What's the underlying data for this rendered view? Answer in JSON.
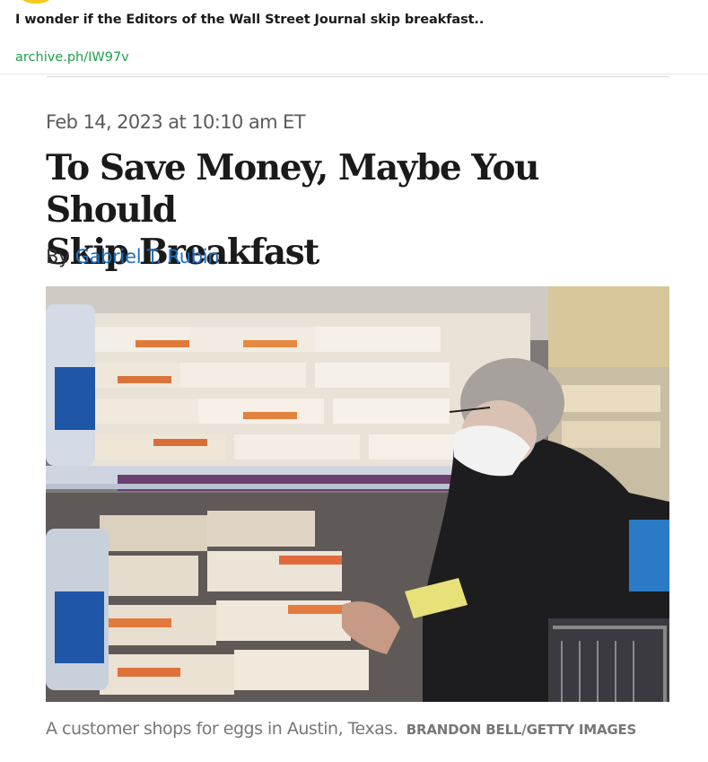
{
  "post": {
    "text": "I wonder if the Editors of the Wall Street Journal skip breakfast..",
    "link": "archive.ph/IW97v"
  },
  "article": {
    "timestamp": "Feb 14, 2023 at 10:10 am ET",
    "headline_line1": "To Save Money, Maybe You Should",
    "headline_line2": "Skip Breakfast",
    "byline_prefix": "By",
    "author": "Gabriel T. Rubin",
    "caption": "A customer shops for eggs in Austin, Texas.",
    "credit": "BRANDON BELL/GETTY IMAGES"
  },
  "colors": {
    "link": "#1fa04b",
    "author": "#1f6fc0",
    "avatar": "#f7c81e"
  }
}
